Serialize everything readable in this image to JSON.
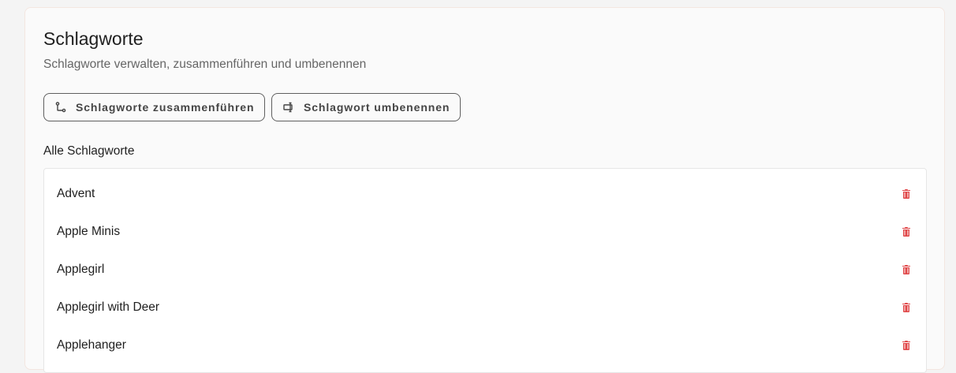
{
  "header": {
    "title": "Schlagworte",
    "subtitle": "Schlagworte verwalten, zusammenführen und umbenennen"
  },
  "toolbar": {
    "merge_label": "Schlagworte zusammenführen",
    "rename_label": "Schlagwort umbenennen"
  },
  "list": {
    "heading": "Alle Schlagworte",
    "items": [
      {
        "label": "Advent",
        "icon": "trash-icon"
      },
      {
        "label": "Apple Minis",
        "icon": "trash-icon"
      },
      {
        "label": "Applegirl",
        "icon": "trash-icon"
      },
      {
        "label": "Applegirl with Deer",
        "icon": "trash-icon"
      },
      {
        "label": "Applehanger",
        "icon": "trash-icon"
      }
    ]
  },
  "colors": {
    "delete": "#e0484a",
    "button_border": "#5f5f5f"
  }
}
